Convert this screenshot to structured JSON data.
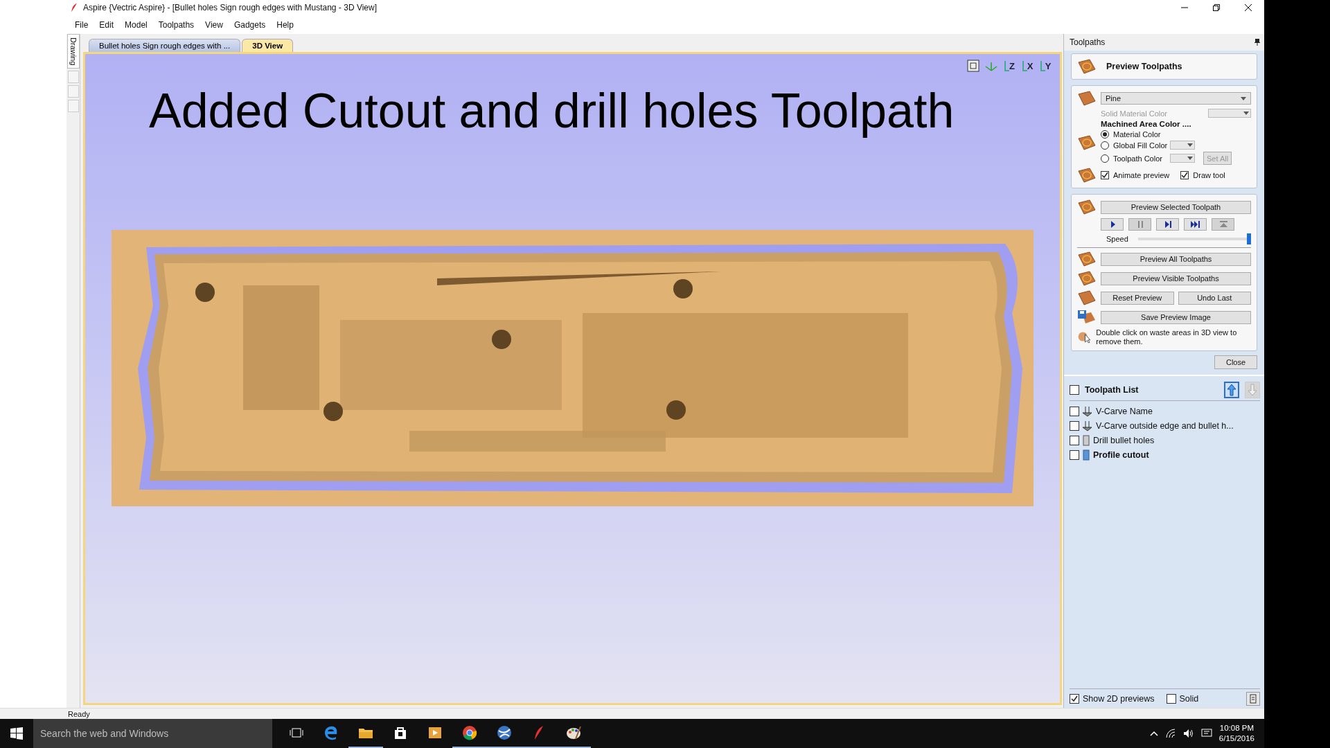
{
  "window": {
    "title": "Aspire {Vectric Aspire} - [Bullet holes Sign rough edges with Mustang - 3D View]"
  },
  "menu": [
    "File",
    "Edit",
    "Model",
    "Toolpaths",
    "View",
    "Gadgets",
    "Help"
  ],
  "side_tabs": [
    {
      "label": "Drawing",
      "selected": true
    }
  ],
  "doc_tabs": [
    {
      "label": "Bullet holes Sign rough edges with ...",
      "selected": false
    },
    {
      "label": "3D View",
      "selected": true
    }
  ],
  "view": {
    "caption": "Added Cutout and drill holes Toolpath",
    "view_buttons": [
      {
        "kind": "fit"
      },
      {
        "kind": "iso"
      },
      {
        "kind": "axis",
        "label": "Z"
      },
      {
        "kind": "axis",
        "label": "X"
      },
      {
        "kind": "axis",
        "label": "Y"
      }
    ]
  },
  "panel": {
    "title": "Toolpaths",
    "heading": "Preview Toolpaths",
    "material": "Pine",
    "solid_color": {
      "label": "Solid Material Color",
      "disabled": true
    },
    "machined_label": "Machined Area Color ....",
    "radios": [
      {
        "label": "Material Color",
        "selected": true,
        "swatch": false
      },
      {
        "label": "Global Fill Color",
        "selected": false,
        "swatch": true
      },
      {
        "label": "Toolpath Color",
        "selected": false,
        "swatch": true
      }
    ],
    "set_all": {
      "label": "Set All",
      "disabled": true
    },
    "options": [
      {
        "label": "Animate preview",
        "checked": true
      },
      {
        "label": "Draw tool",
        "checked": true
      }
    ],
    "preview_selected": "Preview Selected Toolpath",
    "transport": [
      {
        "kind": "play",
        "disabled": false
      },
      {
        "kind": "pause",
        "disabled": true
      },
      {
        "kind": "step",
        "disabled": false
      },
      {
        "kind": "end",
        "disabled": false
      },
      {
        "kind": "top",
        "disabled": true
      }
    ],
    "speed": {
      "label": "Speed",
      "level": 1
    },
    "preview_all": "Preview All Toolpaths",
    "preview_visible": "Preview Visible Toolpaths",
    "reset": "Reset Preview",
    "undo": "Undo Last",
    "save_image": "Save Preview Image",
    "hint": "Double click on waste areas in 3D view to remove them.",
    "close": "Close"
  },
  "toolpath_list": {
    "title": "Toolpath List",
    "checked": false,
    "items": [
      {
        "name": "V-Carve Name",
        "kind": "vcarve",
        "checked": false,
        "selected": false
      },
      {
        "name": "V-Carve outside edge and bullet h...",
        "kind": "vcarve",
        "checked": false,
        "selected": false
      },
      {
        "name": "Drill bullet holes",
        "kind": "drill",
        "checked": false,
        "selected": false
      },
      {
        "name": "Profile cutout",
        "kind": "profile",
        "checked": false,
        "selected": true
      }
    ],
    "footer": [
      {
        "label": "Show 2D previews",
        "checked": true
      },
      {
        "label": "Solid",
        "checked": false
      }
    ]
  },
  "status_bar": "Ready",
  "taskbar": {
    "search": {
      "placeholder": "Search the web and Windows"
    },
    "apps": [
      {
        "kind": "taskview",
        "active": false
      },
      {
        "kind": "edge",
        "active": false
      },
      {
        "kind": "folder",
        "active": true
      },
      {
        "kind": "store",
        "active": false
      },
      {
        "kind": "media",
        "active": false
      },
      {
        "kind": "chrome",
        "active": true
      },
      {
        "kind": "globe",
        "active": true
      },
      {
        "kind": "aspire",
        "active": true
      },
      {
        "kind": "paint",
        "active": true
      }
    ],
    "time": "10:08 PM",
    "date": "6/15/2016"
  }
}
